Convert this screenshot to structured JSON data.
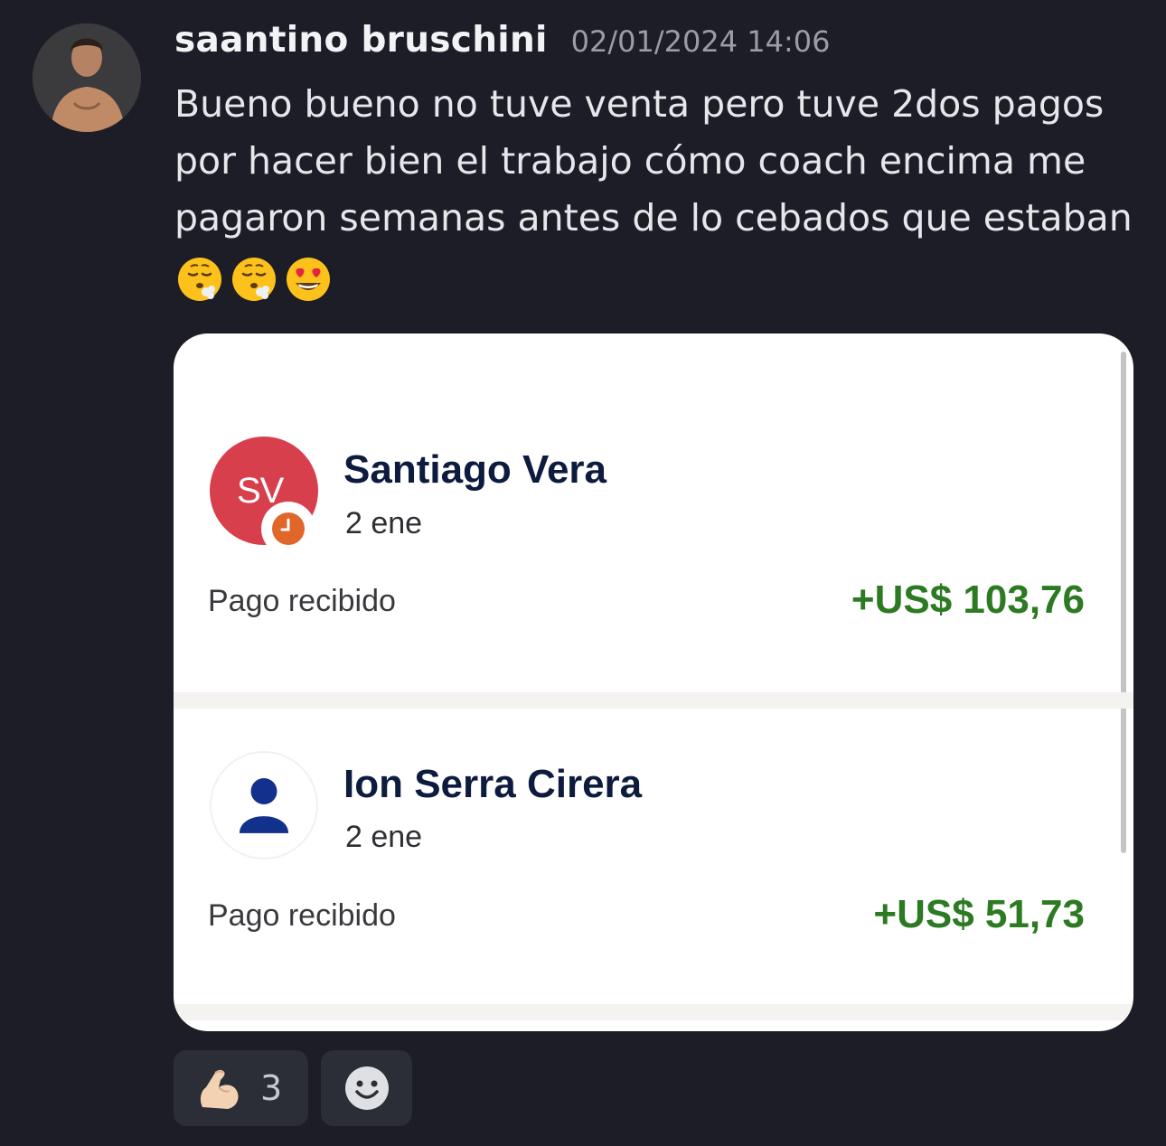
{
  "message": {
    "author": "saantino bruschini",
    "timestamp": "02/01/2024 14:06",
    "text": "Bueno bueno no tuve venta pero tuve 2dos pagos por hacer bien el trabajo cómo coach encima me pagaron semanas antes de lo cebados que estaban",
    "emojis": [
      "face-exhaling-icon",
      "face-exhaling-icon",
      "heart-eyes-icon"
    ]
  },
  "attachment": {
    "transactions": [
      {
        "initials": "SV",
        "name": "Santiago Vera",
        "date": "2 ene",
        "label": "Pago recibido",
        "amount": "+US$ 103,76",
        "avatar_color": "#d83f4d",
        "badge_icon": "clock-icon"
      },
      {
        "name": "Ion Serra Cirera",
        "date": "2 ene",
        "label": "Pago recibido",
        "amount": "+US$ 51,73",
        "avatar_icon": "person-icon",
        "icon_color": "#12318c"
      }
    ],
    "amount_color": "#2c7a22"
  },
  "reactions": [
    {
      "icon": "flexed-biceps-icon",
      "count": "3"
    },
    {
      "icon": "add-reaction-icon"
    }
  ]
}
